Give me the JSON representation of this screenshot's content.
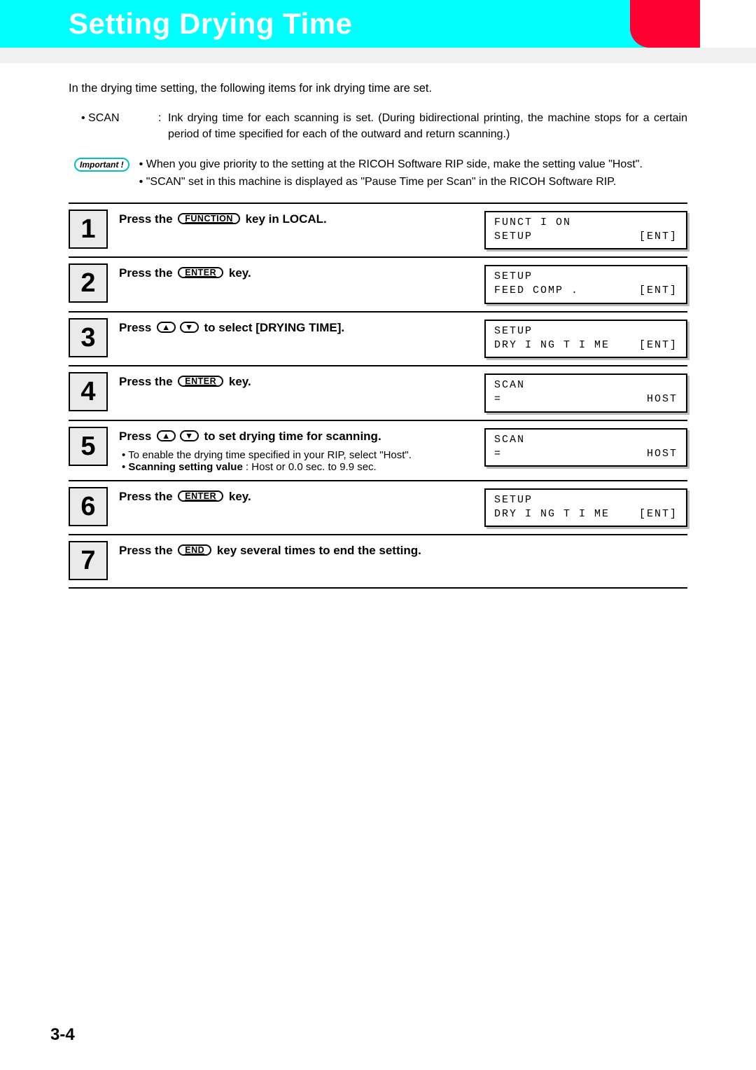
{
  "header": {
    "title": "Setting Drying Time"
  },
  "intro": "In the drying time setting, the following items for ink drying time are set.",
  "scan": {
    "term": "• SCAN",
    "colon": ":",
    "body": "Ink drying time for each scanning is set. (During bidirectional printing, the machine stops for a certain period of time specified for each of the outward and return scanning.)"
  },
  "important": {
    "label": "Important !",
    "lines": [
      "When you give priority to the setting at the RICOH Software RIP side, make the setting value \"Host\".",
      "\"SCAN\" set in this machine is displayed as \"Pause Time per Scan\" in the RICOH Software RIP."
    ]
  },
  "keys": {
    "function": "FUNCTION",
    "enter": "ENTER",
    "end": "END",
    "up": "▲",
    "down": "▼"
  },
  "steps": [
    {
      "num": "1",
      "pre": "Press the ",
      "key1": "function",
      "post": "  key in LOCAL.",
      "lcd": {
        "l1": "FUNCT I ON",
        "l2a": "SETUP",
        "l2b": "[ENT]"
      }
    },
    {
      "num": "2",
      "pre": "Press the ",
      "key1": "enter",
      "post": "  key.",
      "lcd": {
        "l1": "SETUP",
        "l2a": "FEED  COMP .",
        "l2b": "[ENT]"
      }
    },
    {
      "num": "3",
      "pre": "Press ",
      "key1": "up",
      "key2": "down",
      "post": "  to select [DRYING TIME].",
      "lcd": {
        "l1": "SETUP",
        "l2a": "DRY I NG  T I ME",
        "l2b": "[ENT]"
      }
    },
    {
      "num": "4",
      "pre": "Press the ",
      "key1": "enter",
      "post": "  key.",
      "lcd": {
        "l1": "SCAN",
        "l2a": "=",
        "l2b": "HOST"
      }
    },
    {
      "num": "5",
      "pre": "Press ",
      "key1": "up",
      "key2": "down",
      "post": "  to set drying time for scanning.",
      "sub1": "To enable the drying time specified in your RIP, select \"Host\".",
      "sub2a": "Scanning setting value",
      "sub2b": "  : Host or 0.0 sec. to 9.9 sec.",
      "lcd": {
        "l1": "SCAN",
        "l2a": "=",
        "l2b": "HOST"
      }
    },
    {
      "num": "6",
      "pre": "Press the ",
      "key1": "enter",
      "post": "  key.",
      "lcd": {
        "l1": "SETUP",
        "l2a": "DRY I NG  T I ME",
        "l2b": "[ENT]"
      }
    },
    {
      "num": "7",
      "pre": "Press the ",
      "key1": "end",
      "post": " key several times to end the setting."
    }
  ],
  "page_number": "3-4"
}
